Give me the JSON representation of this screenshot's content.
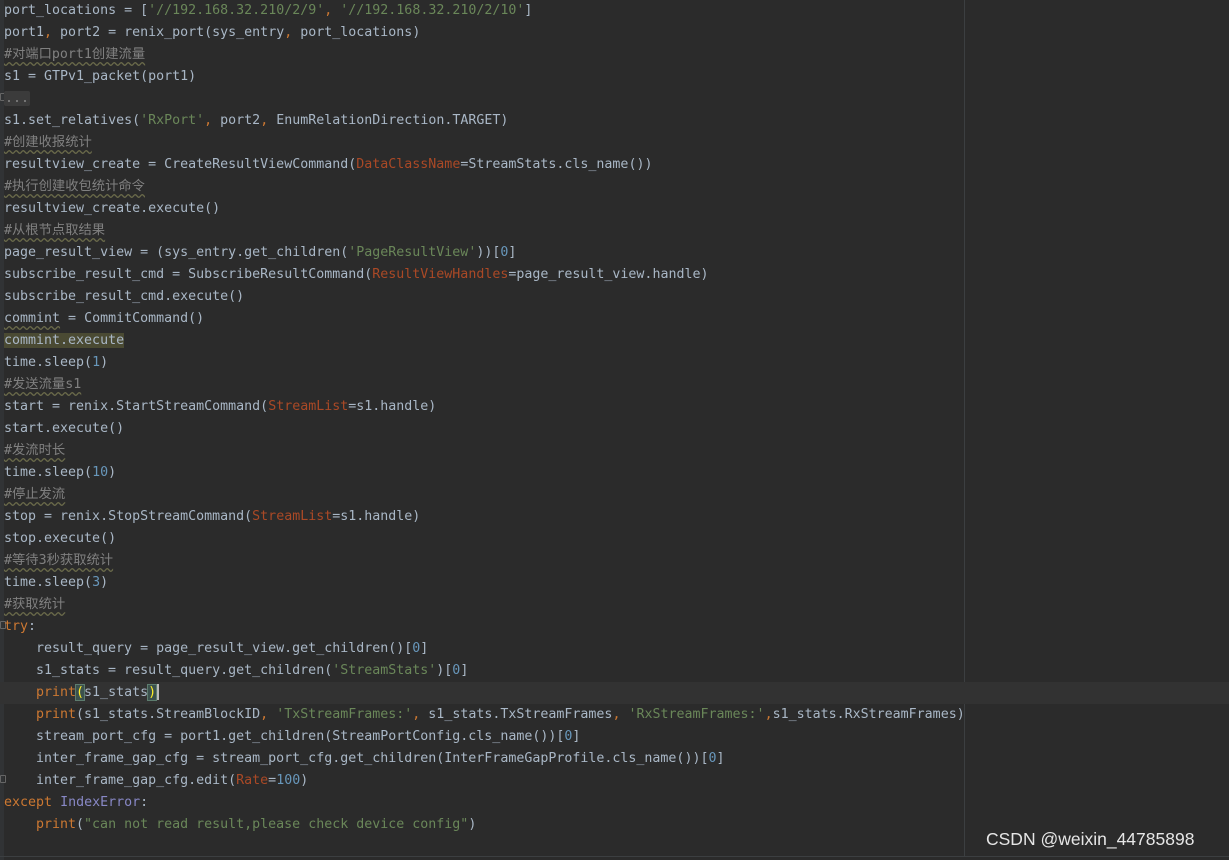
{
  "code_lines": [
    "port_locations = ['//192.168.32.210/2/9', '//192.168.32.210/2/10']",
    "port1, port2 = renix_port(sys_entry, port_locations)",
    "#对端口port1创建流量",
    "s1 = GTPv1_packet(port1)",
    "...",
    "s1.set_relatives('RxPort', port2, EnumRelationDirection.TARGET)",
    "#创建收报统计",
    "resultview_create = CreateResultViewCommand(DataClassName=StreamStats.cls_name())",
    "#执行创建收包统计命令",
    "resultview_create.execute()",
    "#从根节点取结果",
    "page_result_view = (sys_entry.get_children('PageResultView'))[0]",
    "subscribe_result_cmd = SubscribeResultCommand(ResultViewHandles=page_result_view.handle)",
    "subscribe_result_cmd.execute()",
    "commint = CommitCommand()",
    "commint.execute",
    "time.sleep(1)",
    "#发送流量s1",
    "start = renix.StartStreamCommand(StreamList=s1.handle)",
    "start.execute()",
    "#发流时长",
    "time.sleep(10)",
    "#停止发流",
    "stop = renix.StopStreamCommand(StreamList=s1.handle)",
    "stop.execute()",
    "#等待3秒获取统计",
    "time.sleep(3)",
    "#获取统计",
    "try:",
    "    result_query = page_result_view.get_children()[0]",
    "    s1_stats = result_query.get_children('StreamStats')[0]",
    "    print(s1_stats)",
    "    print(s1_stats.StreamBlockID, 'TxStreamFrames:', s1_stats.TxStreamFrames, 'RxStreamFrames:',s1_stats.RxStreamFrames)",
    "    stream_port_cfg = port1.get_children(StreamPortConfig.cls_name())[0]",
    "    inter_frame_gap_cfg = stream_port_cfg.get_children(InterFrameGapProfile.cls_name())[0]",
    "    inter_frame_gap_cfg.edit(Rate=100)",
    "except IndexError:",
    "    print(\"can not read result,please check device config\")"
  ],
  "watermark": "CSDN @weixin_44785898",
  "colors": {
    "background": "#2b2b2b",
    "text": "#a9b7c6",
    "keyword": "#cc7832",
    "string": "#6a8759",
    "number": "#6897bb",
    "kwarg": "#aa4926",
    "comment": "#808080"
  }
}
